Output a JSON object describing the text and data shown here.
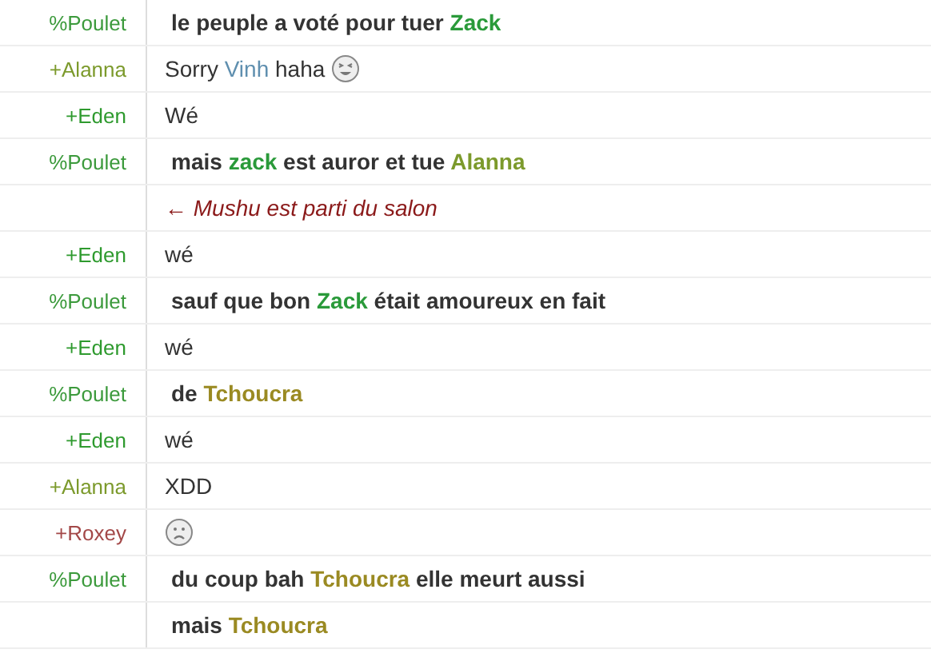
{
  "rows": [
    {
      "nick": {
        "text": "%Poulet",
        "color": "#3c9a3c"
      },
      "kind": "emphasis",
      "segments": [
        {
          "text": "le peuple a voté pour tuer "
        },
        {
          "text": "Zack",
          "color": "#2a9a3a"
        }
      ]
    },
    {
      "nick": {
        "text": "+Alanna",
        "color": "#7c9a2c"
      },
      "kind": "message",
      "segments": [
        {
          "text": "Sorry "
        },
        {
          "text": "Vinh",
          "color": "#5f8faf"
        },
        {
          "text": " haha"
        }
      ],
      "emoji": {
        "kind": "laughing"
      }
    },
    {
      "nick": {
        "text": "+Eden",
        "color": "#2e9a2e"
      },
      "kind": "message",
      "segments": [
        {
          "text": "Wé"
        }
      ]
    },
    {
      "nick": {
        "text": "%Poulet",
        "color": "#3c9a3c"
      },
      "kind": "emphasis",
      "segments": [
        {
          "text": "mais "
        },
        {
          "text": "zack",
          "color": "#2a9a3a"
        },
        {
          "text": " est auror et tue "
        },
        {
          "text": "Alanna",
          "color": "#7c9a2c"
        }
      ]
    },
    {
      "kind": "part",
      "text": "← Mushu est parti du salon"
    },
    {
      "nick": {
        "text": "+Eden",
        "color": "#2e9a2e"
      },
      "kind": "message",
      "segments": [
        {
          "text": "wé"
        }
      ]
    },
    {
      "nick": {
        "text": "%Poulet",
        "color": "#3c9a3c"
      },
      "kind": "emphasis",
      "segments": [
        {
          "text": "sauf que bon "
        },
        {
          "text": "Zack",
          "color": "#2a9a3a"
        },
        {
          "text": " était amoureux en fait"
        }
      ]
    },
    {
      "nick": {
        "text": "+Eden",
        "color": "#2e9a2e"
      },
      "kind": "message",
      "segments": [
        {
          "text": "wé"
        }
      ]
    },
    {
      "nick": {
        "text": "%Poulet",
        "color": "#3c9a3c"
      },
      "kind": "emphasis",
      "segments": [
        {
          "text": "de "
        },
        {
          "text": "Tchoucra",
          "color": "#9a8a22"
        }
      ]
    },
    {
      "nick": {
        "text": "+Eden",
        "color": "#2e9a2e"
      },
      "kind": "message",
      "segments": [
        {
          "text": "wé"
        }
      ]
    },
    {
      "nick": {
        "text": "+Alanna",
        "color": "#7c9a2c"
      },
      "kind": "message",
      "segments": [
        {
          "text": "XDD"
        }
      ]
    },
    {
      "nick": {
        "text": "+Roxey",
        "color": "#a34848"
      },
      "kind": "message",
      "emoji": {
        "kind": "sad"
      }
    },
    {
      "nick": {
        "text": "%Poulet",
        "color": "#3c9a3c"
      },
      "kind": "emphasis",
      "segments": [
        {
          "text": "du coup bah "
        },
        {
          "text": "Tchoucra",
          "color": "#9a8a22"
        },
        {
          "text": " elle meurt aussi"
        }
      ]
    },
    {
      "kind": "emphasis",
      "segments": [
        {
          "text": "mais "
        },
        {
          "text": "Tchoucra",
          "color": "#9a8a22"
        }
      ]
    }
  ]
}
